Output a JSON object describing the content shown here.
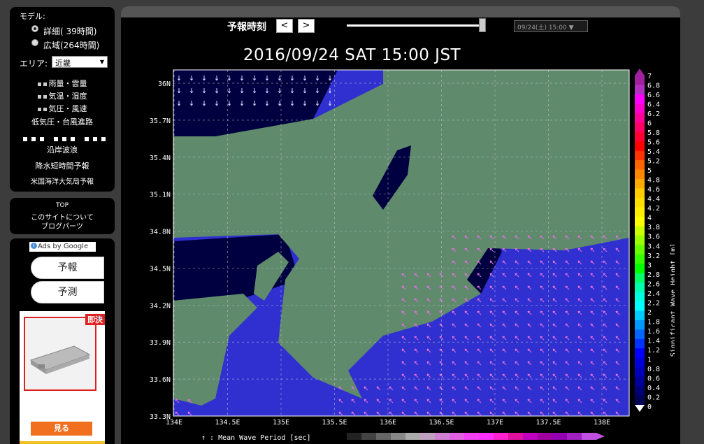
{
  "sidebar": {
    "model_label": "モデル:",
    "models": [
      {
        "label": "詳細(  39時間)",
        "selected": true
      },
      {
        "label": "広域(264時間)",
        "selected": false
      }
    ],
    "area_label": "エリア:",
    "area_value": "近畿",
    "menu": {
      "rain": "雨量・雲量",
      "temp": "気温・湿度",
      "pressure": "気圧・風速",
      "typhoon": "低気圧・台風進路",
      "waves": "沿岸波浪",
      "precip": "降水短時間予報",
      "noaa": "米国海洋大気局予報"
    },
    "about": {
      "top": "TOP",
      "site": "このサイトについて",
      "blogparts": "ブログパーツ"
    },
    "ads": {
      "label": "Ads by Google",
      "links": [
        "予報",
        "予測"
      ],
      "badge": "即決",
      "button": "見る"
    }
  },
  "header": {
    "forecast_label": "予報時刻",
    "prev": "<",
    "next": ">",
    "time_select": "09/24(土) 15:00 ▼",
    "slider_fraction": 1.0
  },
  "title": "2016/09/24  SAT  15:00 JST",
  "map": {
    "lat_ticks": [
      "36N",
      "35.7N",
      "35.4N",
      "35.1N",
      "34.8N",
      "34.5N",
      "34.2N",
      "33.9N",
      "33.6N",
      "33.3N"
    ],
    "lon_ticks": [
      "134E",
      "134.5E",
      "135E",
      "135.5E",
      "136E",
      "136.5E",
      "137E",
      "137.5E",
      "138E"
    ],
    "bottom_label": "↑ : Mean Wave Period [sec]"
  },
  "colorbar": {
    "label": "Significant Wave Height [m]",
    "ticks": [
      "7",
      "6.8",
      "6.6",
      "6.4",
      "6.2",
      "6",
      "5.8",
      "5.6",
      "5.4",
      "5.2",
      "5",
      "4.8",
      "4.6",
      "4.4",
      "4.2",
      "4",
      "3.8",
      "3.6",
      "3.4",
      "3.2",
      "3",
      "2.8",
      "2.6",
      "2.4",
      "2.2",
      "2",
      "1.8",
      "1.6",
      "1.4",
      "1.2",
      "1",
      "0.8",
      "0.6",
      "0.4",
      "0.2",
      "0"
    ],
    "colors": [
      "#a020a0",
      "#b030c0",
      "#ff00ff",
      "#ff00cc",
      "#ff0099",
      "#ff0066",
      "#ff0033",
      "#ff0000",
      "#ff3300",
      "#ff6600",
      "#ff8800",
      "#ffaa00",
      "#ffcc00",
      "#ffdd00",
      "#ffee00",
      "#ffff00",
      "#ccff00",
      "#99ff00",
      "#66ff00",
      "#33ff00",
      "#00ff00",
      "#00ff66",
      "#00ffaa",
      "#00ffdd",
      "#00ffff",
      "#00ccff",
      "#0099ff",
      "#0066ff",
      "#0033ff",
      "#0000ff",
      "#0000dd",
      "#0000bb",
      "#000099",
      "#000077",
      "#000055"
    ]
  },
  "colors": {
    "sea_deep": "#000040",
    "sea_wave": "#3030d0",
    "land": "#5f8a6c",
    "arrow_pink": "#e070e0",
    "arrow_white": "#d0d0ff"
  }
}
